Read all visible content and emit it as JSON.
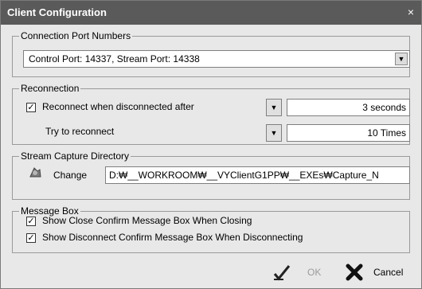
{
  "window": {
    "title": "Client Configuration",
    "close_glyph": "×"
  },
  "connection": {
    "legend": "Connection Port Numbers",
    "selected": "Control Port: 14337, Stream Port: 14338"
  },
  "reconnection": {
    "legend": "Reconnection",
    "reconnect_checkbox": "Reconnect when disconnected after",
    "reconnect_checked": true,
    "delay_value": "3 seconds",
    "try_label": "Try to reconnect",
    "try_value": "10 Times"
  },
  "capture": {
    "legend": "Stream Capture Directory",
    "change_label": "Change",
    "path": "D:₩__WORKROOM₩__VYClientG1PP₩__EXEs₩Capture_N"
  },
  "message_box": {
    "legend": "Message Box",
    "confirm_closing": "Show Close Confirm Message Box When Closing",
    "confirm_closing_checked": true,
    "confirm_disconnect": "Show Disconnect Confirm Message Box When Disconnecting",
    "confirm_disconnect_checked": true
  },
  "buttons": {
    "ok": "OK",
    "cancel": "Cancel"
  },
  "glyphs": {
    "check": "✓",
    "down_arrow": "▼"
  },
  "colors": {
    "titlebar": "#5a5a5a",
    "panel": "#e8e8e8",
    "disabled_text": "#9b9b9b"
  }
}
